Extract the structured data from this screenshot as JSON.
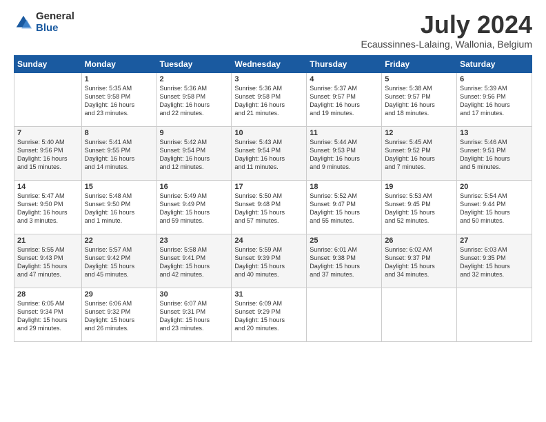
{
  "header": {
    "logo_general": "General",
    "logo_blue": "Blue",
    "month_title": "July 2024",
    "location": "Ecaussinnes-Lalaing, Wallonia, Belgium"
  },
  "days_of_week": [
    "Sunday",
    "Monday",
    "Tuesday",
    "Wednesday",
    "Thursday",
    "Friday",
    "Saturday"
  ],
  "weeks": [
    [
      {
        "day": "",
        "text": ""
      },
      {
        "day": "1",
        "text": "Sunrise: 5:35 AM\nSunset: 9:58 PM\nDaylight: 16 hours\nand 23 minutes."
      },
      {
        "day": "2",
        "text": "Sunrise: 5:36 AM\nSunset: 9:58 PM\nDaylight: 16 hours\nand 22 minutes."
      },
      {
        "day": "3",
        "text": "Sunrise: 5:36 AM\nSunset: 9:58 PM\nDaylight: 16 hours\nand 21 minutes."
      },
      {
        "day": "4",
        "text": "Sunrise: 5:37 AM\nSunset: 9:57 PM\nDaylight: 16 hours\nand 19 minutes."
      },
      {
        "day": "5",
        "text": "Sunrise: 5:38 AM\nSunset: 9:57 PM\nDaylight: 16 hours\nand 18 minutes."
      },
      {
        "day": "6",
        "text": "Sunrise: 5:39 AM\nSunset: 9:56 PM\nDaylight: 16 hours\nand 17 minutes."
      }
    ],
    [
      {
        "day": "7",
        "text": "Sunrise: 5:40 AM\nSunset: 9:56 PM\nDaylight: 16 hours\nand 15 minutes."
      },
      {
        "day": "8",
        "text": "Sunrise: 5:41 AM\nSunset: 9:55 PM\nDaylight: 16 hours\nand 14 minutes."
      },
      {
        "day": "9",
        "text": "Sunrise: 5:42 AM\nSunset: 9:54 PM\nDaylight: 16 hours\nand 12 minutes."
      },
      {
        "day": "10",
        "text": "Sunrise: 5:43 AM\nSunset: 9:54 PM\nDaylight: 16 hours\nand 11 minutes."
      },
      {
        "day": "11",
        "text": "Sunrise: 5:44 AM\nSunset: 9:53 PM\nDaylight: 16 hours\nand 9 minutes."
      },
      {
        "day": "12",
        "text": "Sunrise: 5:45 AM\nSunset: 9:52 PM\nDaylight: 16 hours\nand 7 minutes."
      },
      {
        "day": "13",
        "text": "Sunrise: 5:46 AM\nSunset: 9:51 PM\nDaylight: 16 hours\nand 5 minutes."
      }
    ],
    [
      {
        "day": "14",
        "text": "Sunrise: 5:47 AM\nSunset: 9:50 PM\nDaylight: 16 hours\nand 3 minutes."
      },
      {
        "day": "15",
        "text": "Sunrise: 5:48 AM\nSunset: 9:50 PM\nDaylight: 16 hours\nand 1 minute."
      },
      {
        "day": "16",
        "text": "Sunrise: 5:49 AM\nSunset: 9:49 PM\nDaylight: 15 hours\nand 59 minutes."
      },
      {
        "day": "17",
        "text": "Sunrise: 5:50 AM\nSunset: 9:48 PM\nDaylight: 15 hours\nand 57 minutes."
      },
      {
        "day": "18",
        "text": "Sunrise: 5:52 AM\nSunset: 9:47 PM\nDaylight: 15 hours\nand 55 minutes."
      },
      {
        "day": "19",
        "text": "Sunrise: 5:53 AM\nSunset: 9:45 PM\nDaylight: 15 hours\nand 52 minutes."
      },
      {
        "day": "20",
        "text": "Sunrise: 5:54 AM\nSunset: 9:44 PM\nDaylight: 15 hours\nand 50 minutes."
      }
    ],
    [
      {
        "day": "21",
        "text": "Sunrise: 5:55 AM\nSunset: 9:43 PM\nDaylight: 15 hours\nand 47 minutes."
      },
      {
        "day": "22",
        "text": "Sunrise: 5:57 AM\nSunset: 9:42 PM\nDaylight: 15 hours\nand 45 minutes."
      },
      {
        "day": "23",
        "text": "Sunrise: 5:58 AM\nSunset: 9:41 PM\nDaylight: 15 hours\nand 42 minutes."
      },
      {
        "day": "24",
        "text": "Sunrise: 5:59 AM\nSunset: 9:39 PM\nDaylight: 15 hours\nand 40 minutes."
      },
      {
        "day": "25",
        "text": "Sunrise: 6:01 AM\nSunset: 9:38 PM\nDaylight: 15 hours\nand 37 minutes."
      },
      {
        "day": "26",
        "text": "Sunrise: 6:02 AM\nSunset: 9:37 PM\nDaylight: 15 hours\nand 34 minutes."
      },
      {
        "day": "27",
        "text": "Sunrise: 6:03 AM\nSunset: 9:35 PM\nDaylight: 15 hours\nand 32 minutes."
      }
    ],
    [
      {
        "day": "28",
        "text": "Sunrise: 6:05 AM\nSunset: 9:34 PM\nDaylight: 15 hours\nand 29 minutes."
      },
      {
        "day": "29",
        "text": "Sunrise: 6:06 AM\nSunset: 9:32 PM\nDaylight: 15 hours\nand 26 minutes."
      },
      {
        "day": "30",
        "text": "Sunrise: 6:07 AM\nSunset: 9:31 PM\nDaylight: 15 hours\nand 23 minutes."
      },
      {
        "day": "31",
        "text": "Sunrise: 6:09 AM\nSunset: 9:29 PM\nDaylight: 15 hours\nand 20 minutes."
      },
      {
        "day": "",
        "text": ""
      },
      {
        "day": "",
        "text": ""
      },
      {
        "day": "",
        "text": ""
      }
    ]
  ]
}
